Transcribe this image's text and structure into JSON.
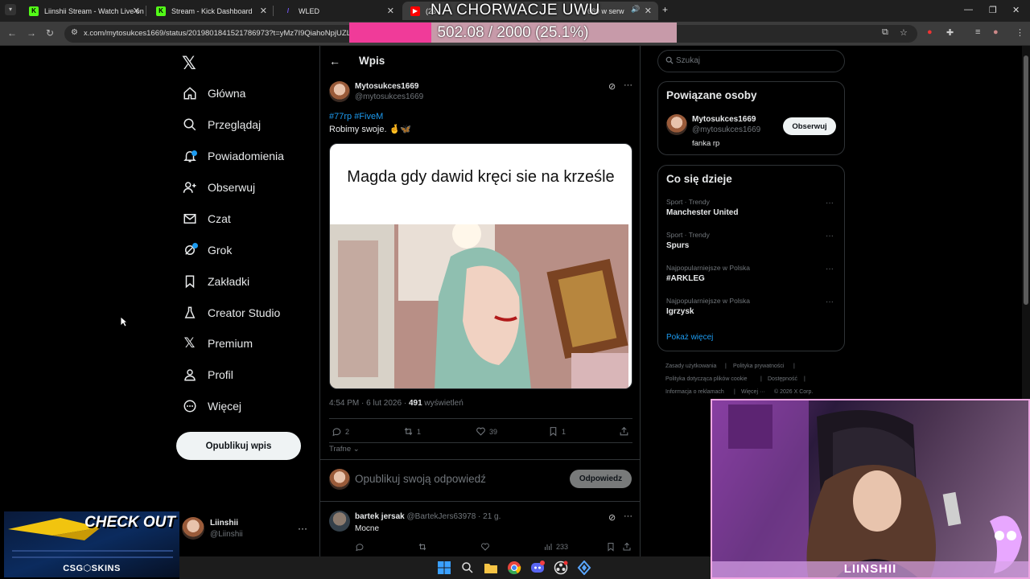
{
  "browser": {
    "tabs": [
      {
        "title": "Liinshii Stream - Watch Live on",
        "favicon": "kick-icon",
        "color": "#53fc18"
      },
      {
        "title": "Stream - Kick Dashboard",
        "favicon": "kick-icon",
        "color": "#53fc18"
      },
      {
        "title": "WLED",
        "favicon": "wled-icon",
        "color": "#7a5cff"
      },
      {
        "title": "(23",
        "title_suffix": "669 w serw",
        "favicon": "youtube-icon",
        "color": "#ff0000"
      }
    ],
    "url": "x.com/mytosukces1669/status/2019801841521786973?t=yMz7I9QiahoNpjUZLiC"
  },
  "overlay": {
    "goal_title": "NA CHORWACJE UWU",
    "goal_text": "502.08 / 2000 (25.1%)",
    "goal_fraction": 0.251
  },
  "nav": {
    "items": [
      {
        "label": "Główna",
        "icon": "home-icon"
      },
      {
        "label": "Przeglądaj",
        "icon": "search-icon"
      },
      {
        "label": "Powiadomienia",
        "icon": "bell-icon"
      },
      {
        "label": "Obserwuj",
        "icon": "follow-icon"
      },
      {
        "label": "Czat",
        "icon": "mail-icon"
      },
      {
        "label": "Grok",
        "icon": "grok-icon"
      },
      {
        "label": "Zakładki",
        "icon": "bookmark-icon"
      },
      {
        "label": "Creator Studio",
        "icon": "creator-icon"
      },
      {
        "label": "Premium",
        "icon": "x-icon"
      },
      {
        "label": "Profil",
        "icon": "profile-icon"
      },
      {
        "label": "Więcej",
        "icon": "more-icon"
      }
    ],
    "post_button": "Opublikuj wpis",
    "account": {
      "name": "Liinshii",
      "handle": "@Liinshii"
    }
  },
  "post": {
    "header_title": "Wpis",
    "author_name": "Mytosukces1669",
    "author_handle": "@mytosukces1669",
    "tags": "#77rp #FiveM",
    "text": "Robimy swoje. 🤞🦋",
    "media_caption": "Magda gdy dawid kręci sie na krześle",
    "time": "4:54 PM · 6 lut 2026 ·",
    "views": "491",
    "views_label": "wyświetleń",
    "replies": "2",
    "reposts": "1",
    "likes": "39",
    "bookmarks": "1",
    "sort_label": "Trafne",
    "reply_placeholder": "Opublikuj swoją odpowiedź",
    "reply_button": "Odpowiedz"
  },
  "comment": {
    "name": "bartek jersak",
    "handle": "@BartekJers63978 · 21 g.",
    "text": "Mocne",
    "views": "233"
  },
  "sidebar": {
    "search_placeholder": "Szukaj",
    "people_title": "Powiązane osoby",
    "person": {
      "name": "Mytosukces1669",
      "handle": "@mytosukces1669",
      "bio": "fanka rp",
      "follow": "Obserwuj"
    },
    "trends_title": "Co się dzieje",
    "trends": [
      {
        "meta": "Sport · Trendy",
        "name": "Manchester United"
      },
      {
        "meta": "Sport · Trendy",
        "name": "Spurs"
      },
      {
        "meta": "Najpopularniejsze w Polska",
        "name": "#ARKLEG"
      },
      {
        "meta": "Najpopularniejsze w Polska",
        "name": "Igrzysk"
      }
    ],
    "show_more": "Pokaż więcej",
    "footer": [
      "Zasady użytkowania",
      "|",
      "Polityka prywatności",
      "|",
      "Polityka dotycząca plików cookie",
      "|",
      "Dostępność",
      "|",
      "Informacja o reklamach",
      "|",
      "Więcej ···",
      "© 2026 X Corp."
    ]
  },
  "webcam": {
    "caption": "LIINSHII"
  },
  "promo": {
    "title": "CHECK OUT",
    "brand": "CSG⬡SKINS"
  }
}
